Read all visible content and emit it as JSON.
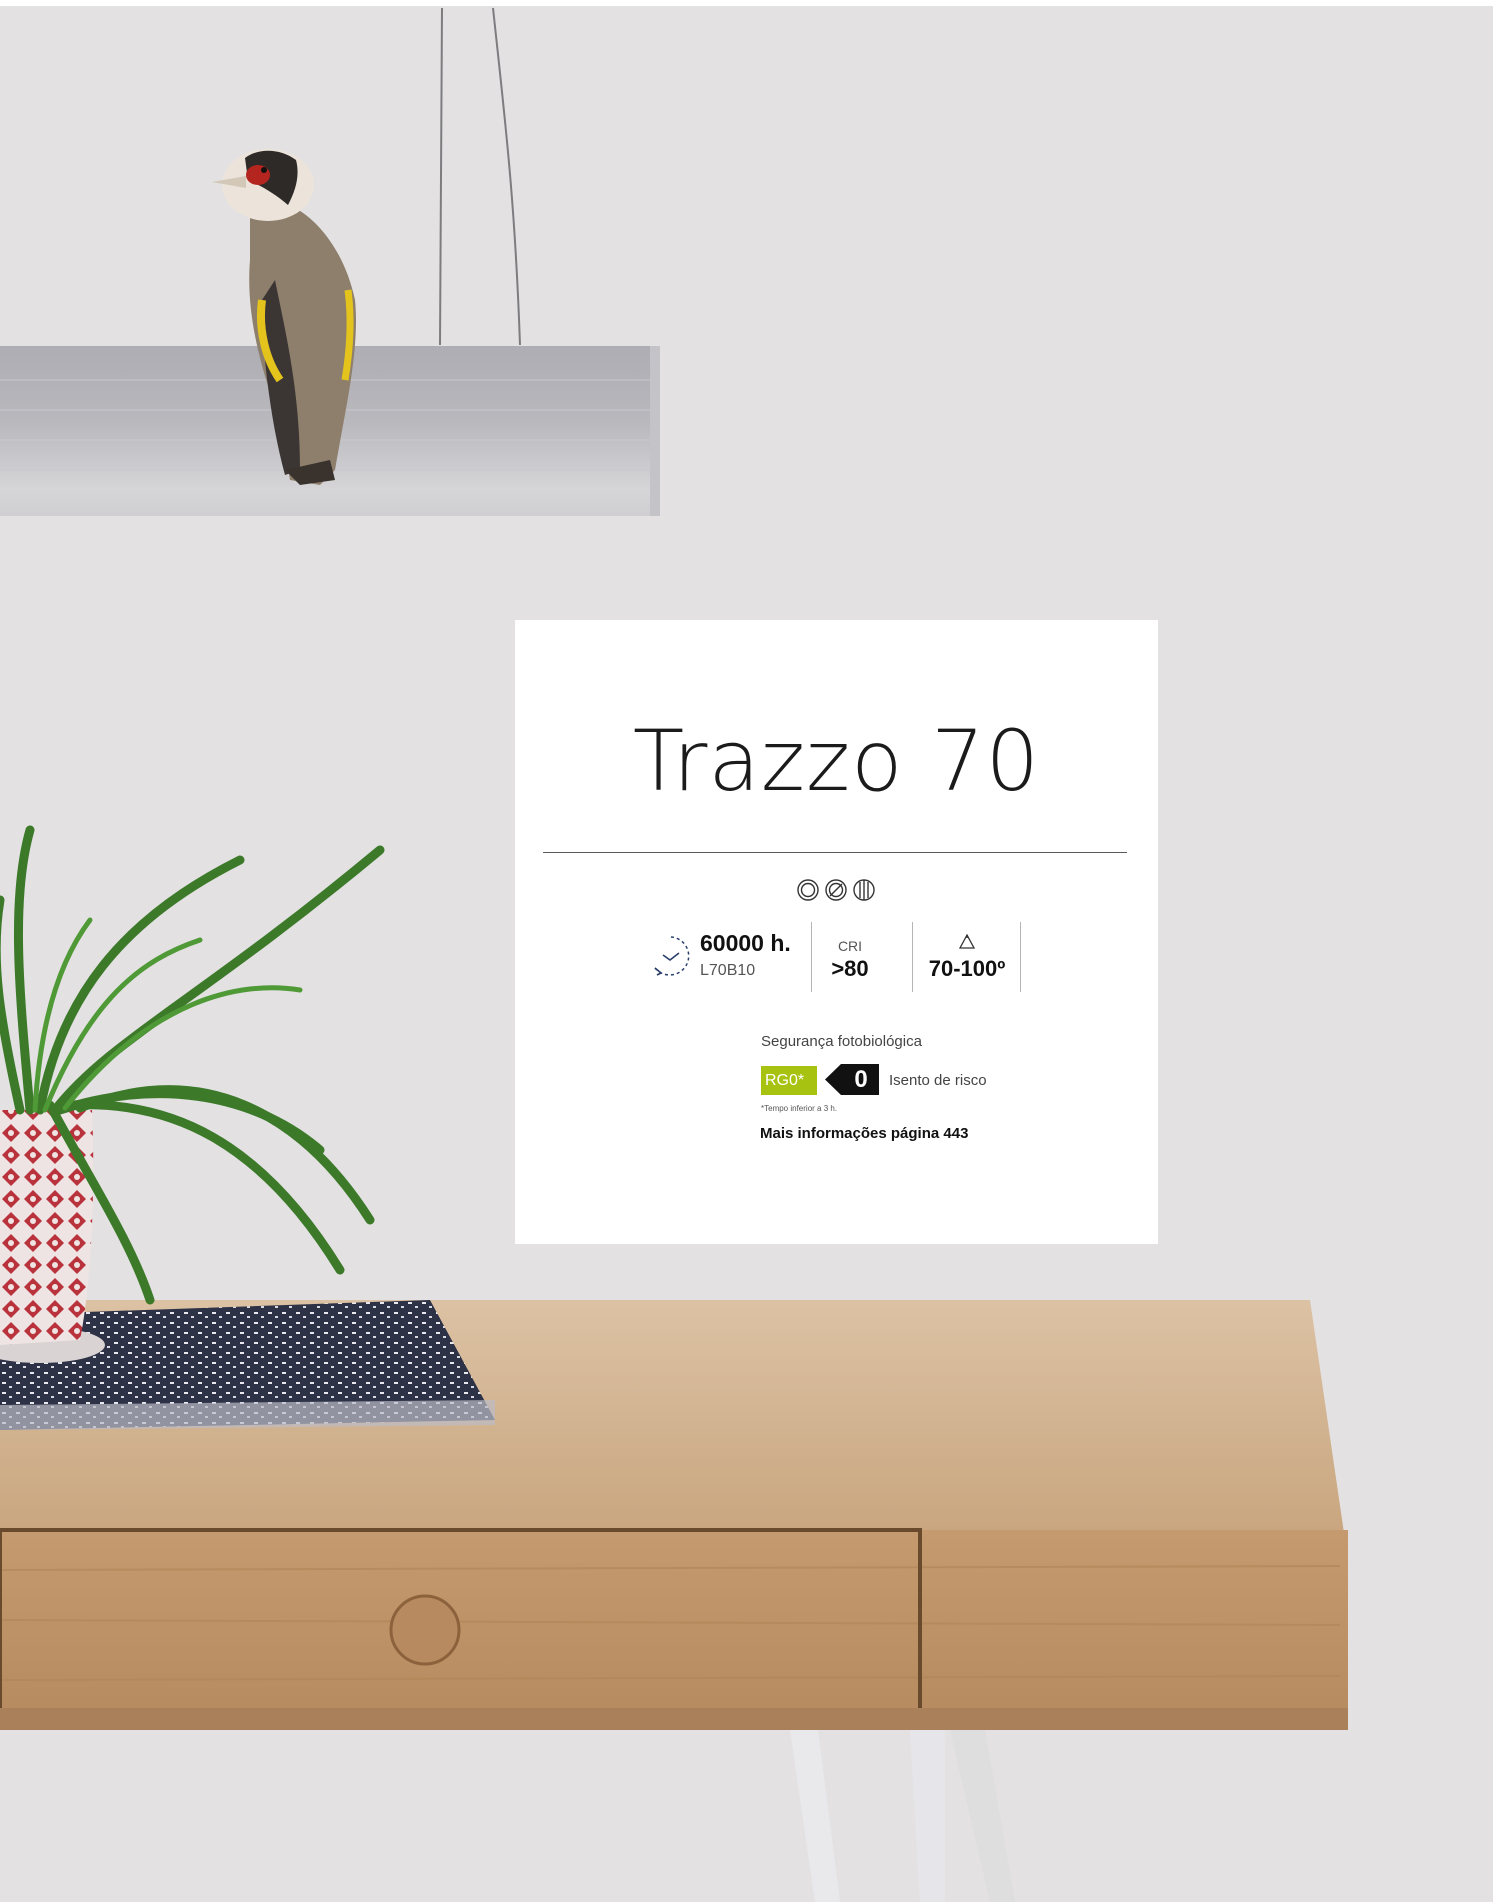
{
  "product": {
    "name": "Trazzo 70",
    "mounting_icons": [
      "recessed-mount-icon",
      "surface-mount-icon",
      "suspended-mount-icon"
    ],
    "specs": {
      "lifetime_value": "60000 h.",
      "lifetime_code": "L70B10",
      "cri_label": "CRI",
      "cri_value": ">80",
      "beam_angle": "70-100º"
    },
    "photobiological": {
      "label": "Segurança fotobiológica",
      "risk_group": "RG0*",
      "risk_number": "0",
      "risk_text": "Isento de risco",
      "footnote": "*Tempo inferior a 3 h."
    },
    "more_info": "Mais informações página 443"
  },
  "colors": {
    "background": "#e3e1e2",
    "accent_green": "#a8c212",
    "wood": "#c9a27a"
  }
}
